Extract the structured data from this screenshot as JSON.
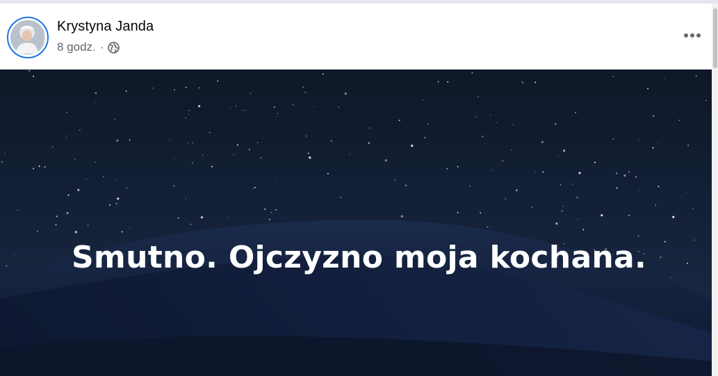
{
  "post": {
    "author": "Krystyna Janda",
    "time": "8 godz.",
    "separator": "·",
    "audience_icon": "globe-icon",
    "more_icon": "more-horizontal-icon"
  },
  "image": {
    "caption_text": "Smutno. Ojczyzno moja kochana.",
    "background_colors": {
      "sky_top": "#0f1a2b",
      "sky_bottom": "#1b2a45",
      "dune_dark": "#101b33",
      "dune_mid": "#1a2847"
    }
  },
  "colors": {
    "accent": "#1b74e4",
    "name_text": "#050505",
    "meta_text": "#65676b"
  }
}
